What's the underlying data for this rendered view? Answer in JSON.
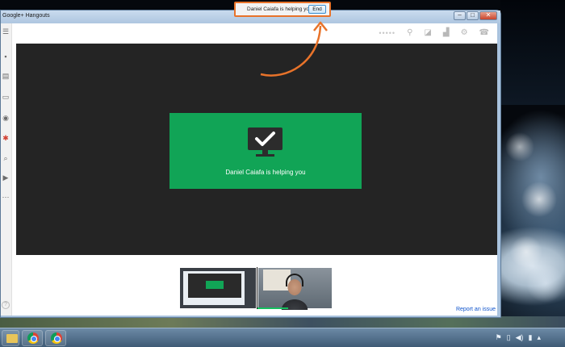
{
  "window": {
    "title": "Google+ Hangouts",
    "controls": [
      "minimize",
      "maximize",
      "close"
    ]
  },
  "help_bar": {
    "message": "Daniel Caiafa is helping you.",
    "end_label": "End"
  },
  "stage": {
    "card_message": "Daniel Caiafa is helping you",
    "card_icon": "monitor-check-icon",
    "card_color": "#11a456"
  },
  "left_rail": {
    "icons": [
      "menu-icon",
      "contacts-icon",
      "chat-icon",
      "screenshare-icon",
      "camera-icon",
      "hangouts-app-icon",
      "search-icon",
      "youtube-icon",
      "more-icon",
      "help-icon"
    ]
  },
  "toolbar": {
    "icons": [
      "dots-icon",
      "mute-mic-icon",
      "mute-video-icon",
      "bandwidth-icon",
      "settings-icon",
      "leave-call-icon"
    ]
  },
  "footer": {
    "report_link": "Report an issue"
  },
  "taskbar": {
    "items": [
      "windows-explorer-icon",
      "chrome-icon",
      "chrome-icon"
    ]
  },
  "colors": {
    "accent_orange": "#e8732a",
    "link_blue": "#1155cc"
  }
}
